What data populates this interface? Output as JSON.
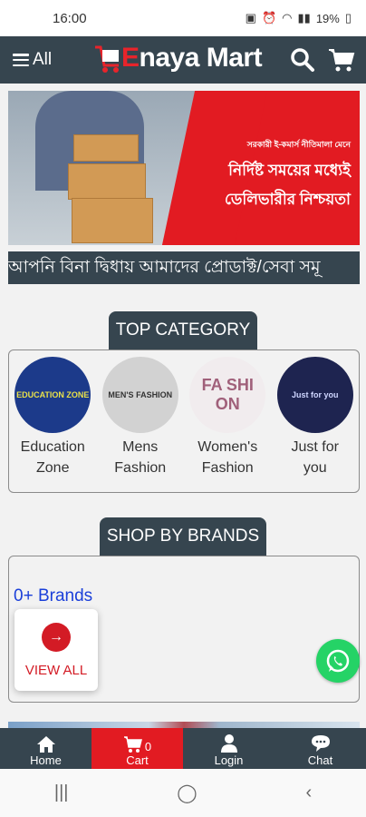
{
  "status_bar": {
    "time": "16:00",
    "battery": "19%"
  },
  "header": {
    "menu_label": "All",
    "logo_e": "E",
    "logo_rest": "naya Mart"
  },
  "banner": {
    "line1": "সরকারী ই-কমার্স নীতিমালা মেনে",
    "line2": "নির্দিষ্ট সময়ের মধ্যেই",
    "line3": "ডেলিভারীর নিশ্চয়তা"
  },
  "marquee": {
    "text": "আপনি বিনা দ্বিধায় আমাদের প্রোডাক্ট/সেবা সমূ"
  },
  "top_category": {
    "title": "TOP CATEGORY",
    "items": [
      {
        "line1": "Education",
        "line2": "Zone",
        "img_text": "EDUCATION ZONE"
      },
      {
        "line1": "Mens",
        "line2": "Fashion",
        "img_text": "MEN'S FASHION"
      },
      {
        "line1": "Women's",
        "line2": "Fashion",
        "img_text": "FA SHI ON"
      },
      {
        "line1": "Just for",
        "line2": "you",
        "img_text": "Just for you"
      }
    ]
  },
  "brands": {
    "title": "SHOP BY BRANDS",
    "count_label": "0+ Brands",
    "view_all": "VIEW ALL"
  },
  "bottom_nav": {
    "home": "Home",
    "cart": "Cart",
    "cart_count": "0",
    "login": "Login",
    "chat": "Chat"
  },
  "colors": {
    "header_bg": "#36454f",
    "accent_red": "#e21b22",
    "link_blue": "#1a3fd9"
  }
}
